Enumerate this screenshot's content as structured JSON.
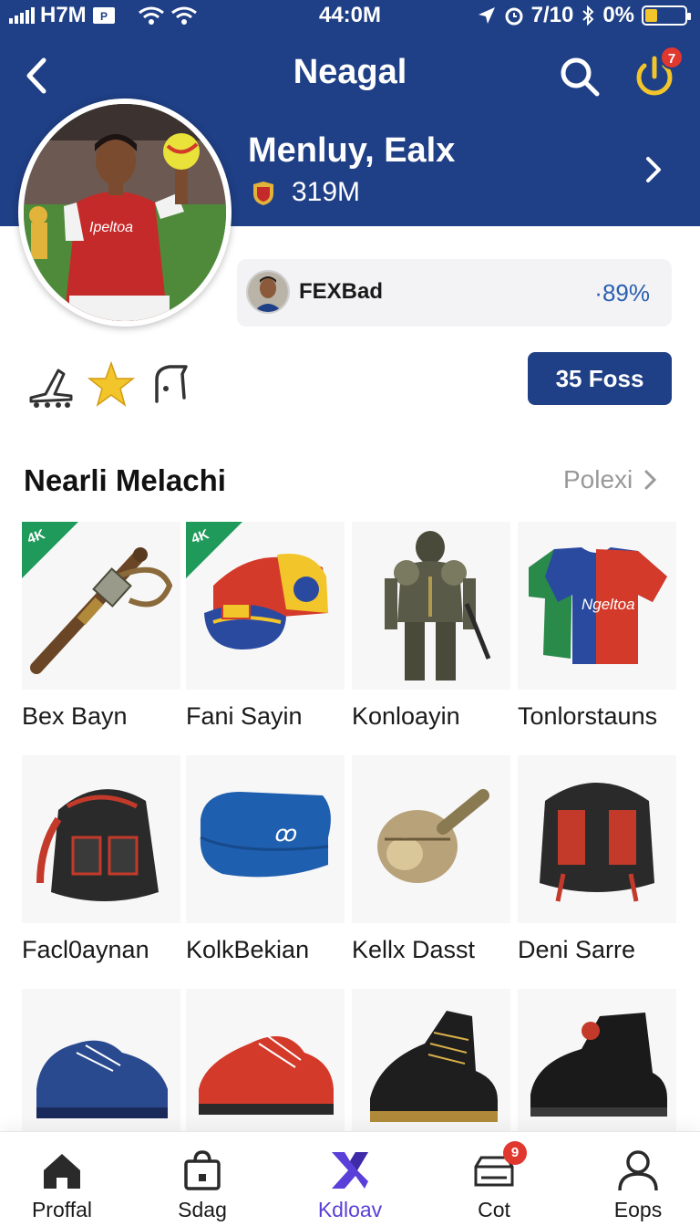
{
  "status_bar": {
    "carrier": "H7M",
    "time": "44:0M",
    "right_text": "7/10",
    "battery_text": "0%",
    "colors": {
      "battery": "#f2c52b"
    }
  },
  "header": {
    "title": "Neagal",
    "notification_count": "7",
    "colors": {
      "background": "#1f3f86",
      "badge": "#e0372f"
    }
  },
  "profile": {
    "name": "Menluy, Ealx",
    "followers": "319M",
    "jersey_text": "Ipeltoa"
  },
  "stat_card": {
    "label": "FEXBad",
    "value": "·89%"
  },
  "achievement_icons": [
    "shoe-icon",
    "star-icon",
    "shirt-icon"
  ],
  "follow_button": {
    "label": "35 Foss"
  },
  "section": {
    "title": "Nearli Melachi",
    "link": "Polexi"
  },
  "products": [
    {
      "name": "Bex Bayn",
      "tag": "4K",
      "icon": "rifle-icon"
    },
    {
      "name": "Fani Sayin",
      "tag": "4K",
      "icon": "cap-icon"
    },
    {
      "name": "Konloayin",
      "tag": "",
      "icon": "armor-figure-icon"
    },
    {
      "name": "Tonlorstauns",
      "tag": "",
      "icon": "jersey-icon",
      "jersey_text": "Ngeltoa"
    },
    {
      "name": "Facl0aynan",
      "tag": "",
      "icon": "bag-icon"
    },
    {
      "name": "KolkBekian",
      "tag": "",
      "icon": "towel-icon"
    },
    {
      "name": "Kellx Dasst",
      "tag": "",
      "icon": "helmet-icon"
    },
    {
      "name": "Deni Sarre",
      "tag": "",
      "icon": "backpack-icon"
    },
    {
      "name": "",
      "tag": "",
      "icon": "blue-shoe-icon"
    },
    {
      "name": "",
      "tag": "",
      "icon": "red-shoe-icon"
    },
    {
      "name": "",
      "tag": "",
      "icon": "black-boot-icon"
    },
    {
      "name": "",
      "tag": "",
      "icon": "black-shoe-icon"
    }
  ],
  "bottom_nav": [
    {
      "label": "Proffal",
      "icon": "home-icon"
    },
    {
      "label": "Sdag",
      "icon": "shopping-bag-icon"
    },
    {
      "label": "Kdloav",
      "icon": "logo-icon",
      "active": true
    },
    {
      "label": "Cot",
      "icon": "store-icon",
      "badge": "9"
    },
    {
      "label": "Eops",
      "icon": "person-icon"
    }
  ],
  "colors": {
    "accent": "#1f3f86",
    "active_nav": "#5a3fd8",
    "tag": "#1f9a5a",
    "stat_value": "#2a5fb0"
  }
}
